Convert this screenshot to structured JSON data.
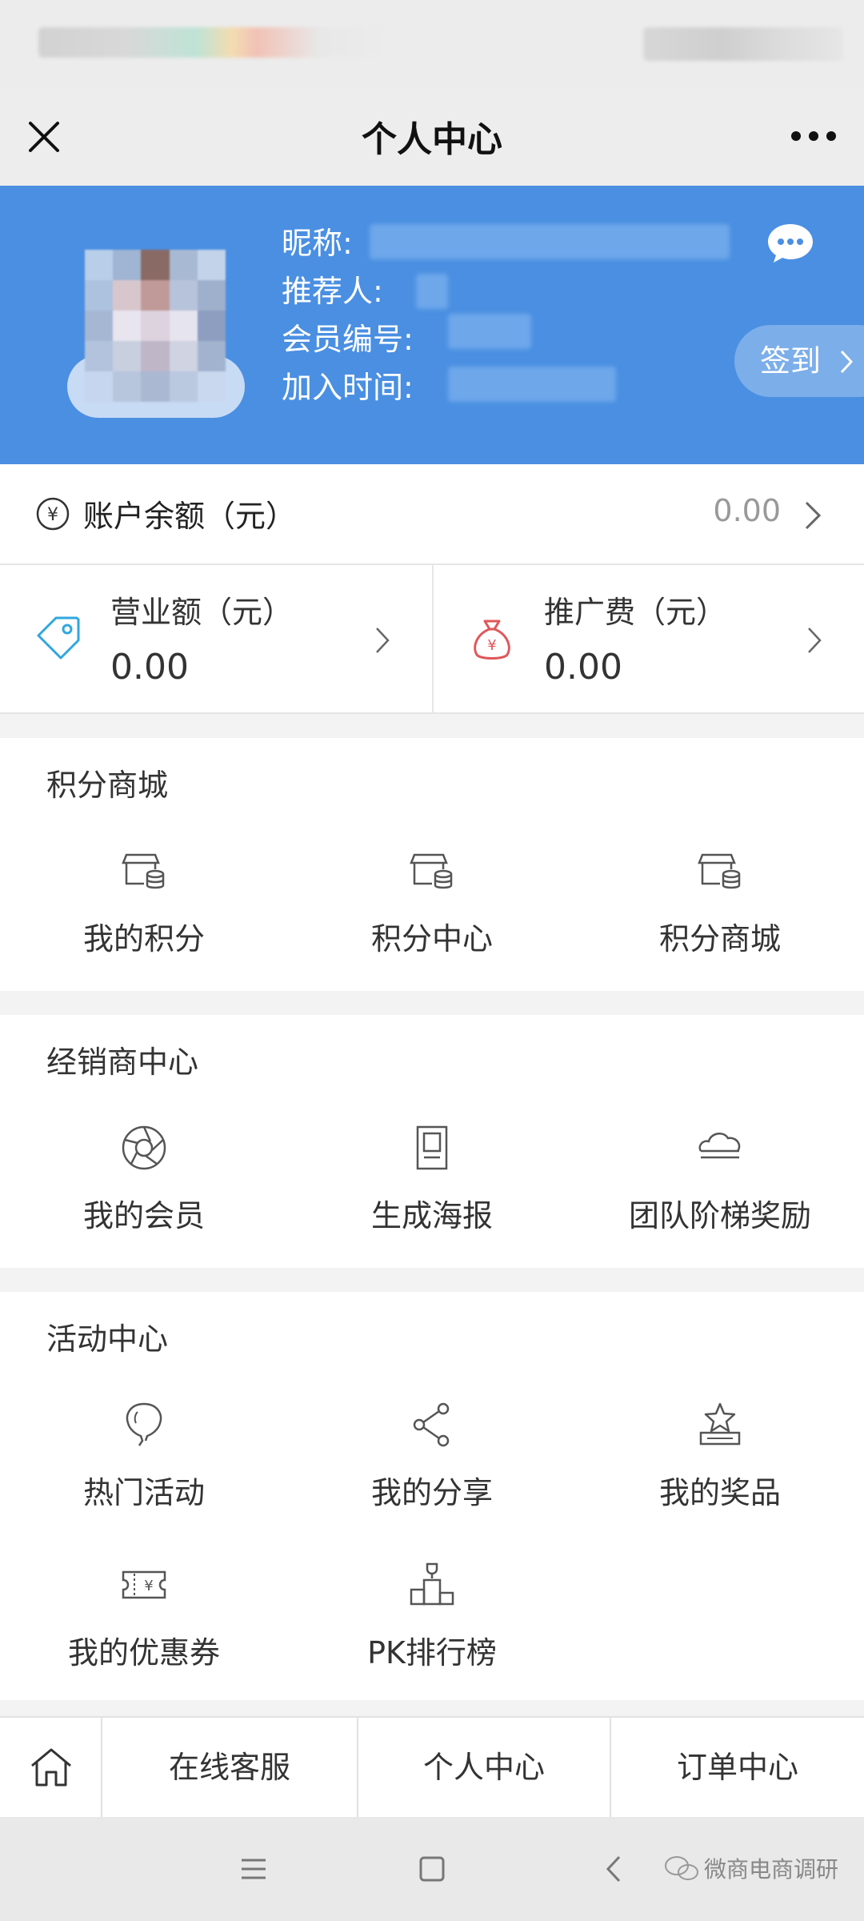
{
  "header": {
    "title": "个人中心"
  },
  "profile": {
    "nickname_label": "昵称:",
    "referrer_label": "推荐人:",
    "member_no_label": "会员编号:",
    "join_time_label": "加入时间:",
    "signin_label": "签到"
  },
  "balance": {
    "label": "账户余额（元）",
    "amount": "0.00"
  },
  "cards": [
    {
      "label": "营业额（元）",
      "value": "0.00",
      "icon": "price-tag-icon"
    },
    {
      "label": "推广费（元）",
      "value": "0.00",
      "icon": "money-bag-icon"
    }
  ],
  "sections": [
    {
      "title": "积分商城",
      "items": [
        {
          "label": "我的积分",
          "icon": "store-coins-icon"
        },
        {
          "label": "积分中心",
          "icon": "store-coins-icon"
        },
        {
          "label": "积分商城",
          "icon": "store-coins-icon"
        }
      ]
    },
    {
      "title": "经销商中心",
      "items": [
        {
          "label": "我的会员",
          "icon": "aperture-icon"
        },
        {
          "label": "生成海报",
          "icon": "poster-icon"
        },
        {
          "label": "团队阶梯奖励",
          "icon": "cloud-stairs-icon"
        }
      ]
    },
    {
      "title": "活动中心",
      "items": [
        {
          "label": "热门活动",
          "icon": "balloon-icon"
        },
        {
          "label": "我的分享",
          "icon": "share-icon"
        },
        {
          "label": "我的奖品",
          "icon": "star-trophy-icon"
        },
        {
          "label": "我的优惠券",
          "icon": "coupon-icon"
        },
        {
          "label": "PK排行榜",
          "icon": "podium-icon"
        }
      ]
    }
  ],
  "tabbar": {
    "tabs": [
      {
        "label": "在线客服"
      },
      {
        "label": "个人中心"
      },
      {
        "label": "订单中心"
      }
    ]
  },
  "watermark": "微商电商调研",
  "colors": {
    "header_bg": "#4a8fe2",
    "page_bg": "#f3f3f3",
    "card_bg": "#ffffff"
  }
}
